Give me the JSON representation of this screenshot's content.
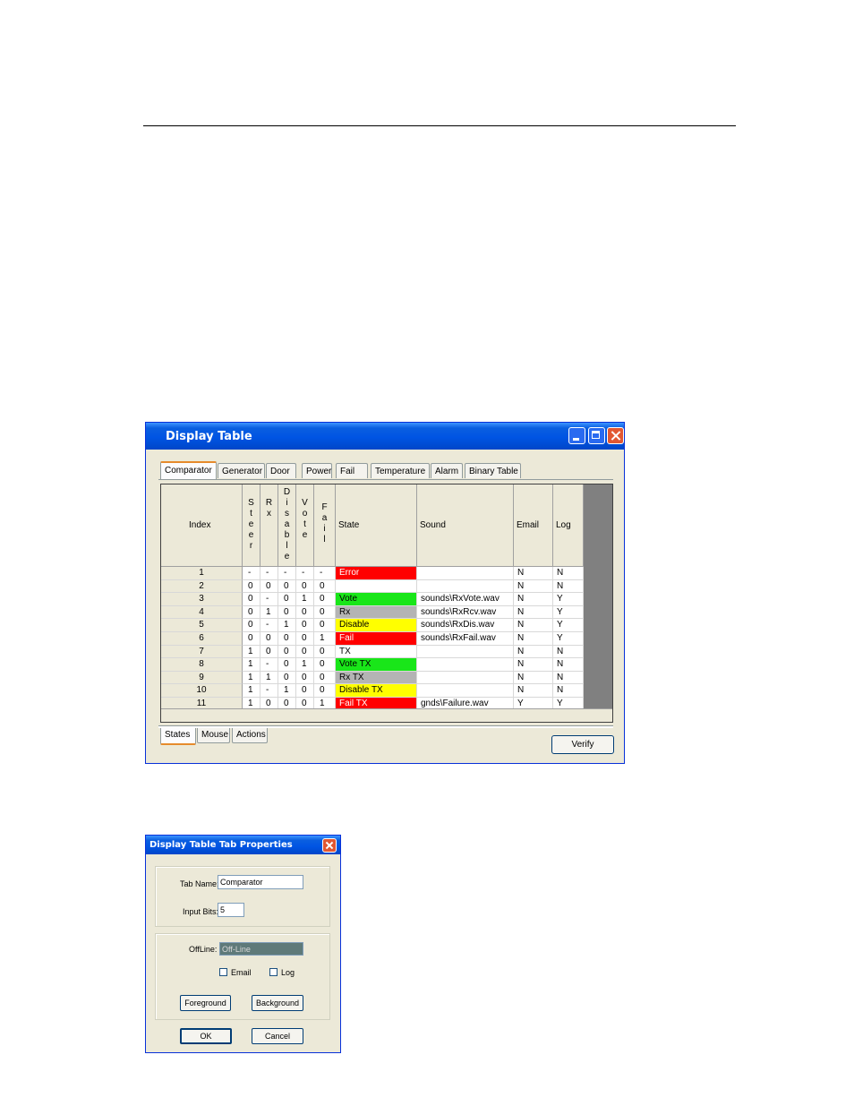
{
  "display_table": {
    "title": "Display Table",
    "tabs": [
      "Comparator",
      "Generator",
      "Door",
      "Power",
      "Fail",
      "Temperature",
      "Alarm",
      "Binary Table"
    ],
    "columns": {
      "index": "Index",
      "steer": "S\nt\ne\ne\nr",
      "rx": "R\nx",
      "disable": "D\ni\ns\na\nb\nl\ne",
      "vote": "V\no\nt\ne",
      "fail": "F\na\ni\nl",
      "state": "State",
      "sound": "Sound",
      "email": "Email",
      "log": "Log"
    },
    "rows": [
      {
        "index": "1",
        "steer": "-",
        "rx": "-",
        "disable": "-",
        "vote": "-",
        "fail": "-",
        "state": "Error",
        "state_bg": "#ff0000",
        "state_fg": "#ffffff",
        "sound": "",
        "email": "N",
        "log": "N"
      },
      {
        "index": "2",
        "steer": "0",
        "rx": "0",
        "disable": "0",
        "vote": "0",
        "fail": "0",
        "state": "",
        "state_bg": "#ffffff",
        "state_fg": "#000000",
        "sound": "",
        "email": "N",
        "log": "N"
      },
      {
        "index": "3",
        "steer": "0",
        "rx": "-",
        "disable": "0",
        "vote": "1",
        "fail": "0",
        "state": "Vote",
        "state_bg": "#19e619",
        "state_fg": "#000000",
        "sound": "sounds\\RxVote.wav",
        "email": "N",
        "log": "Y"
      },
      {
        "index": "4",
        "steer": "0",
        "rx": "1",
        "disable": "0",
        "vote": "0",
        "fail": "0",
        "state": "Rx",
        "state_bg": "#b4b4b4",
        "state_fg": "#000000",
        "sound": "sounds\\RxRcv.wav",
        "email": "N",
        "log": "Y"
      },
      {
        "index": "5",
        "steer": "0",
        "rx": "-",
        "disable": "1",
        "vote": "0",
        "fail": "0",
        "state": "Disable",
        "state_bg": "#ffff00",
        "state_fg": "#000000",
        "sound": "sounds\\RxDis.wav",
        "email": "N",
        "log": "Y"
      },
      {
        "index": "6",
        "steer": "0",
        "rx": "0",
        "disable": "0",
        "vote": "0",
        "fail": "1",
        "state": "Fail",
        "state_bg": "#ff0000",
        "state_fg": "#ffffff",
        "sound": "sounds\\RxFail.wav",
        "email": "N",
        "log": "Y"
      },
      {
        "index": "7",
        "steer": "1",
        "rx": "0",
        "disable": "0",
        "vote": "0",
        "fail": "0",
        "state": "TX",
        "state_bg": "#ffffff",
        "state_fg": "#000000",
        "sound": "",
        "email": "N",
        "log": "N"
      },
      {
        "index": "8",
        "steer": "1",
        "rx": "-",
        "disable": "0",
        "vote": "1",
        "fail": "0",
        "state": "Vote TX",
        "state_bg": "#19e619",
        "state_fg": "#000000",
        "sound": "",
        "email": "N",
        "log": "N"
      },
      {
        "index": "9",
        "steer": "1",
        "rx": "1",
        "disable": "0",
        "vote": "0",
        "fail": "0",
        "state": "Rx TX",
        "state_bg": "#b4b4b4",
        "state_fg": "#000000",
        "sound": "",
        "email": "N",
        "log": "N"
      },
      {
        "index": "10",
        "steer": "1",
        "rx": "-",
        "disable": "1",
        "vote": "0",
        "fail": "0",
        "state": "Disable TX",
        "state_bg": "#ffff00",
        "state_fg": "#000000",
        "sound": "",
        "email": "N",
        "log": "N"
      },
      {
        "index": "11",
        "steer": "1",
        "rx": "0",
        "disable": "0",
        "vote": "0",
        "fail": "1",
        "state": "Fail TX",
        "state_bg": "#ff0000",
        "state_fg": "#ffffff",
        "sound": "gnds\\Failure.wav",
        "email": "Y",
        "log": "Y"
      }
    ],
    "bottom_tabs": [
      "States",
      "Mouse",
      "Actions"
    ],
    "verify_label": "Verify"
  },
  "tab_properties": {
    "title": "Display Table Tab Properties",
    "tab_name_label": "Tab Name:",
    "tab_name_value": "Comparator",
    "input_bits_label": "Input Bits:",
    "input_bits_value": "5",
    "offline_label": "OffLine:",
    "offline_value": "Off-Line",
    "email_label": "Email",
    "log_label": "Log",
    "foreground_label": "Foreground",
    "background_label": "Background",
    "ok_label": "OK",
    "cancel_label": "Cancel"
  }
}
